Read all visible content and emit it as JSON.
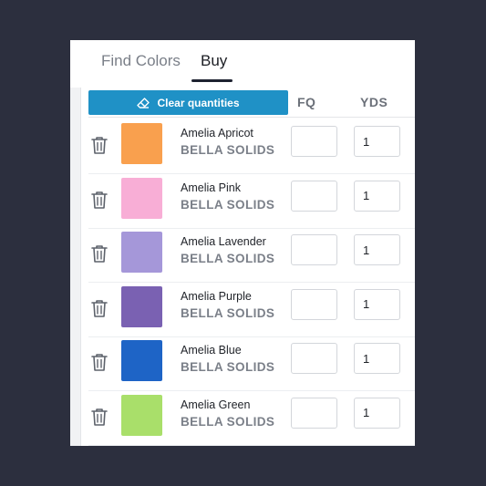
{
  "tabs": [
    {
      "label": "Find Colors",
      "active": false
    },
    {
      "label": "Buy",
      "active": true
    }
  ],
  "toolbar": {
    "clear_label": "Clear quantities",
    "clear_icon": "eraser-icon",
    "accent_color": "#1f91c6"
  },
  "columns": {
    "fq": "FQ",
    "yds": "YDS"
  },
  "rows": [
    {
      "name": "Amelia Apricot",
      "brand": "BELLA SOLIDS",
      "color": "#f9a04e",
      "fq": "",
      "yds": "1"
    },
    {
      "name": "Amelia Pink",
      "brand": "BELLA SOLIDS",
      "color": "#f8aed6",
      "fq": "",
      "yds": "1"
    },
    {
      "name": "Amelia Lavender",
      "brand": "BELLA SOLIDS",
      "color": "#a597d9",
      "fq": "",
      "yds": "1"
    },
    {
      "name": "Amelia Purple",
      "brand": "BELLA SOLIDS",
      "color": "#7a61b2",
      "fq": "",
      "yds": "1"
    },
    {
      "name": "Amelia Blue",
      "brand": "BELLA SOLIDS",
      "color": "#1e64c6",
      "fq": "",
      "yds": "1"
    },
    {
      "name": "Amelia Green",
      "brand": "BELLA SOLIDS",
      "color": "#a9df6a",
      "fq": "",
      "yds": "1"
    }
  ]
}
